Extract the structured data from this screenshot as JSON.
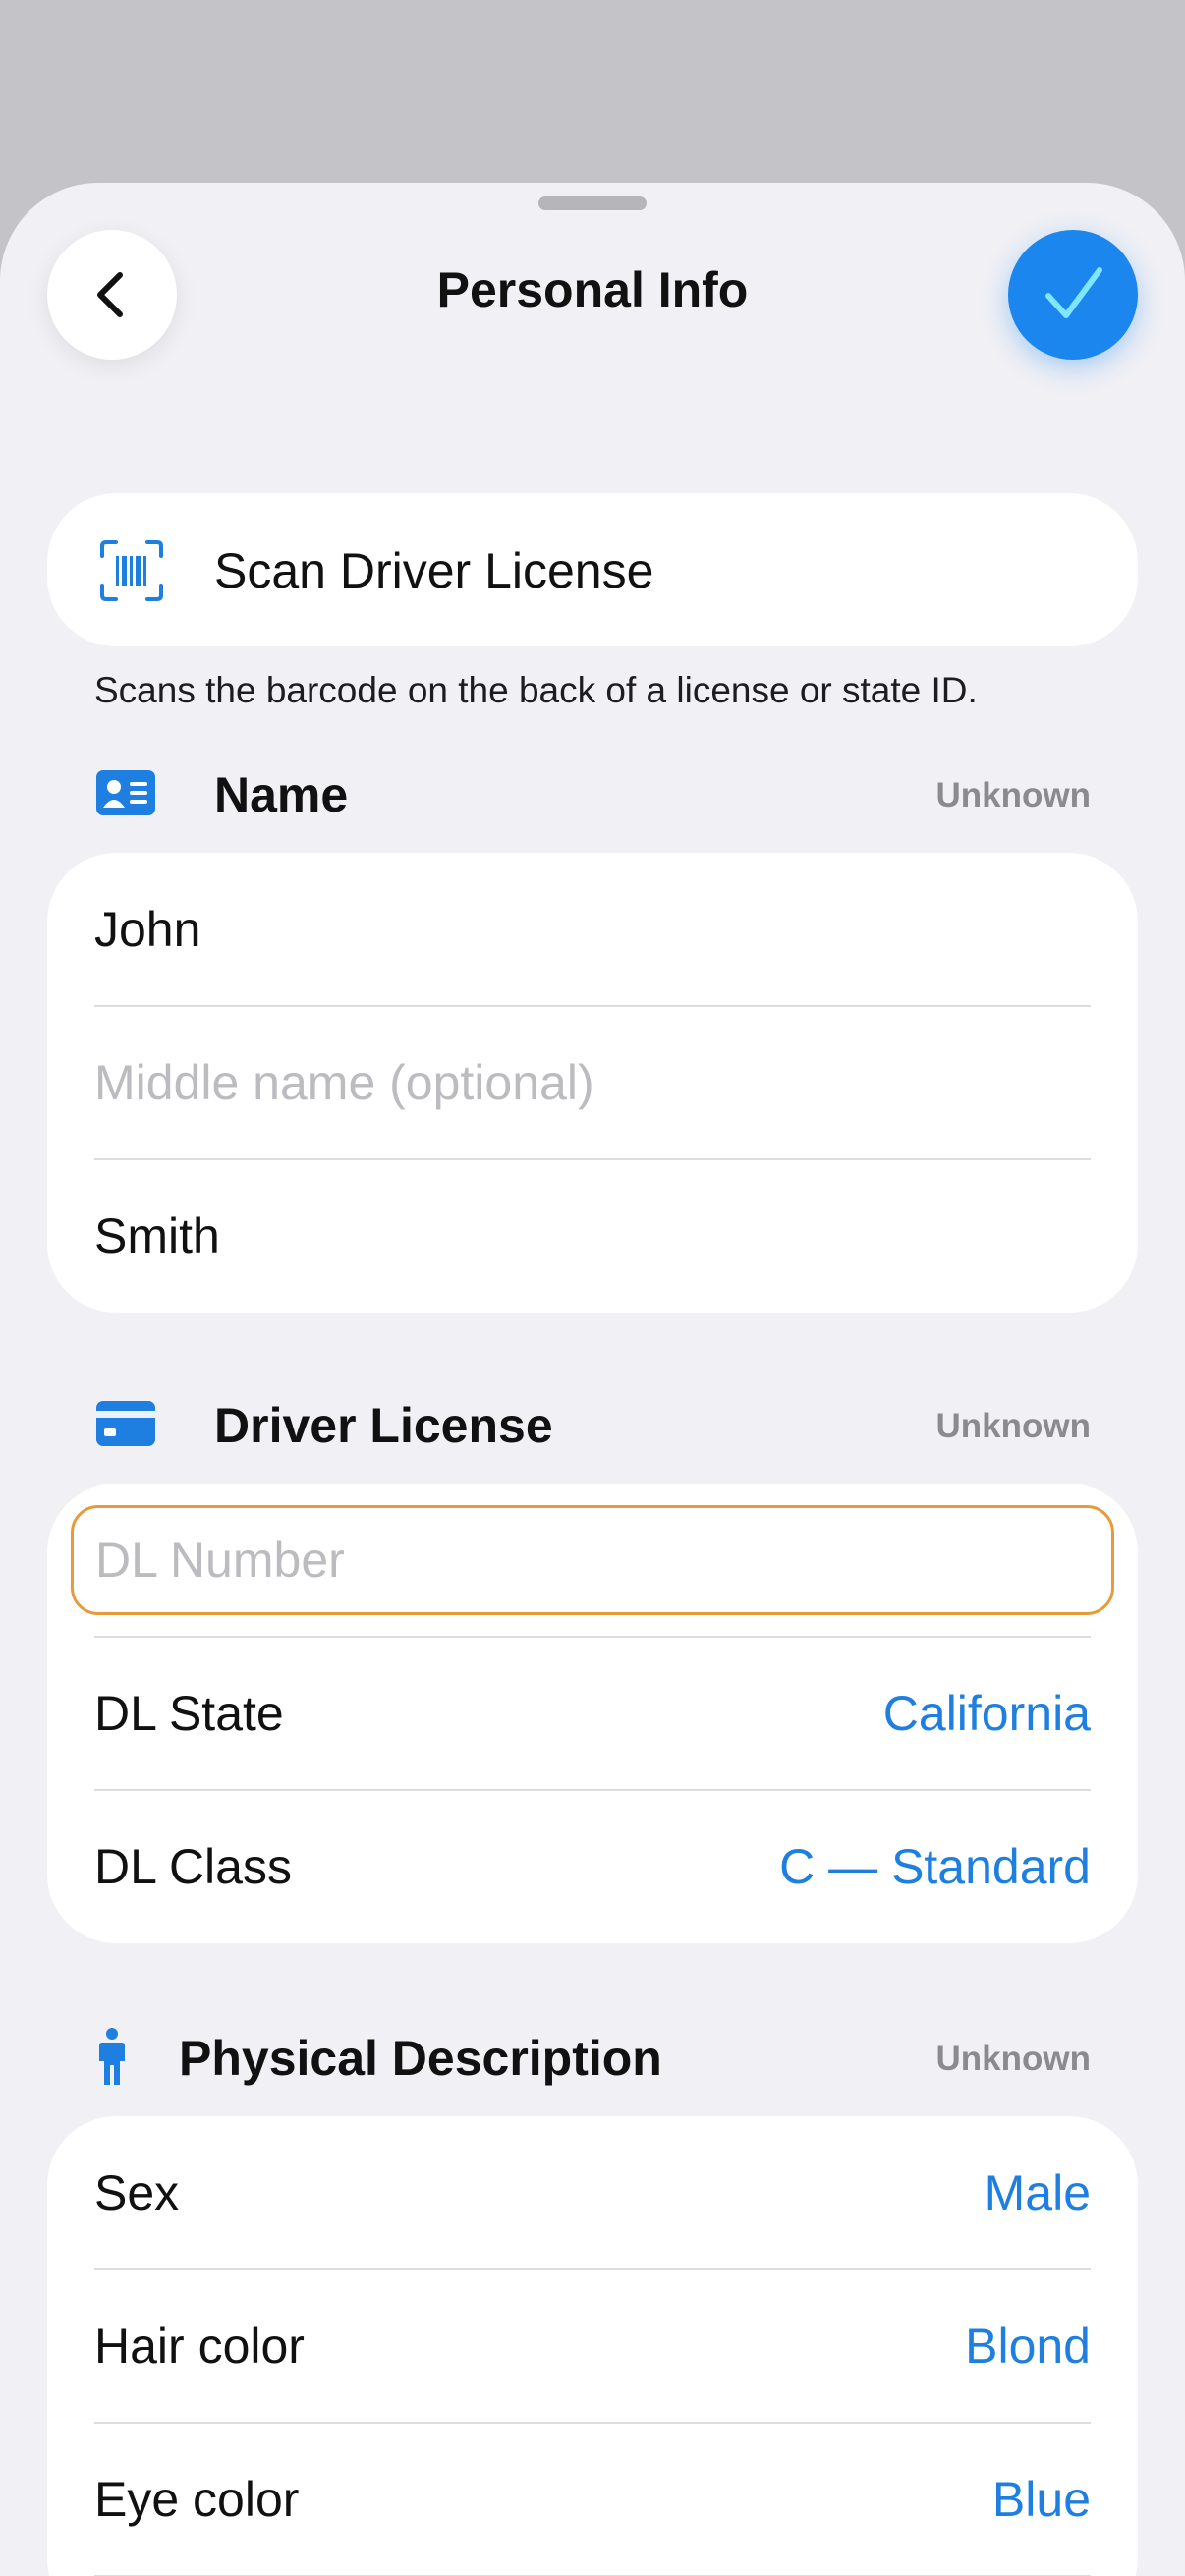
{
  "header": {
    "title": "Personal Info"
  },
  "scan": {
    "label": "Scan Driver License",
    "helper": "Scans the barcode on the back of a license or state ID."
  },
  "name_section": {
    "title": "Name",
    "status": "Unknown",
    "first": "John",
    "middle_placeholder": "Middle name (optional)",
    "last": "Smith"
  },
  "license_section": {
    "title": "Driver License",
    "status": "Unknown",
    "number_placeholder": "DL Number",
    "state_label": "DL State",
    "state_value": "California",
    "class_label": "DL Class",
    "class_value": "C — Standard"
  },
  "physical_section": {
    "title": "Physical Description",
    "status": "Unknown",
    "sex_label": "Sex",
    "sex_value": "Male",
    "hair_label": "Hair color",
    "hair_value": "Blond",
    "eye_label": "Eye color",
    "eye_value": "Blue"
  },
  "colors": {
    "accent": "#1f7fe0",
    "confirm": "#1a86ee",
    "focus_border": "#e89a3a"
  },
  "icons": {
    "back": "chevron-left-icon",
    "confirm": "checkmark-icon",
    "scan": "barcode-scan-icon",
    "name": "person-card-icon",
    "license": "credit-card-icon",
    "physical": "person-figure-icon"
  }
}
